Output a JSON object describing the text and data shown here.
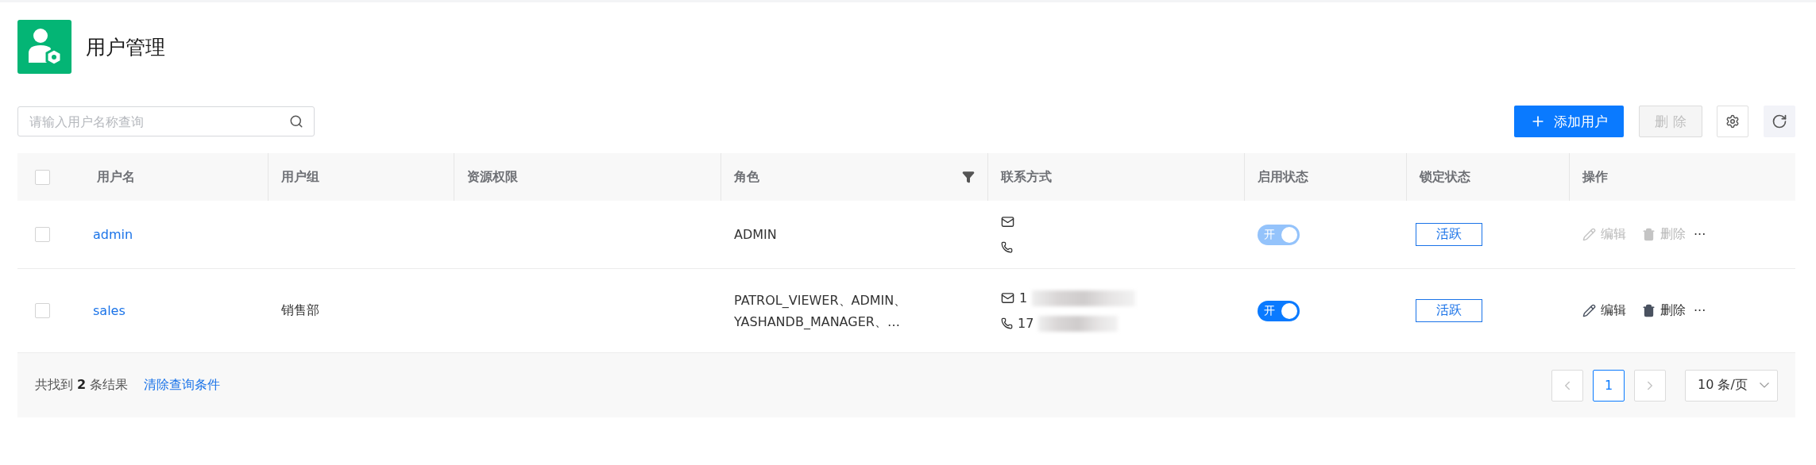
{
  "page": {
    "title": "用户管理"
  },
  "search": {
    "placeholder": "请输入用户名称查询"
  },
  "toolbar": {
    "add_button": {
      "label": "添加用户"
    },
    "delete_button": {
      "label": "删 除",
      "disabled": true
    }
  },
  "table": {
    "select_all": {
      "checked": false
    },
    "columns": [
      {
        "label": "用户名"
      },
      {
        "label": "用户组"
      },
      {
        "label": "资源权限"
      },
      {
        "label": "角色",
        "filter": true
      },
      {
        "label": "联系方式"
      },
      {
        "label": "启用状态"
      },
      {
        "label": "锁定状态"
      },
      {
        "label": "操作"
      }
    ],
    "rows": [
      {
        "checked": false,
        "username": "admin",
        "roles": [
          "ADMIN"
        ],
        "contacts": [
          {
            "kind": "email"
          },
          {
            "kind": "phone"
          }
        ],
        "enabled": {
          "label": "开",
          "on": true,
          "disabled": true
        },
        "lock_status": "活跃",
        "actions": [
          {
            "kind": "edit",
            "label": "编辑",
            "disabled": true
          },
          {
            "kind": "delete",
            "label": "删除",
            "disabled": true
          },
          {
            "kind": "more",
            "label": "···"
          }
        ]
      },
      {
        "checked": false,
        "username": "sales",
        "group": "销售部",
        "roles": [
          "PATROL_VIEWER、ADMIN、",
          "YASHANDB_MANAGER、…"
        ],
        "contacts": [
          {
            "kind": "email",
            "text": "1",
            "redacted": true
          },
          {
            "kind": "phone",
            "text": "17",
            "redacted": true
          }
        ],
        "enabled": {
          "label": "开",
          "on": true,
          "disabled": false
        },
        "lock_status": "活跃",
        "actions": [
          {
            "kind": "edit",
            "label": "编辑",
            "disabled": false
          },
          {
            "kind": "delete",
            "label": "删除",
            "disabled": false
          },
          {
            "kind": "more",
            "label": "···"
          }
        ]
      }
    ]
  },
  "footer": {
    "summary": "共找到 **2** 条结果",
    "clear_link": "清除查询条件",
    "pagination": {
      "prev": {
        "disabled": true
      },
      "pages": [
        {
          "label": "1",
          "selected": true
        }
      ],
      "next": {
        "disabled": true
      },
      "page_size": "10 条/页"
    }
  }
}
